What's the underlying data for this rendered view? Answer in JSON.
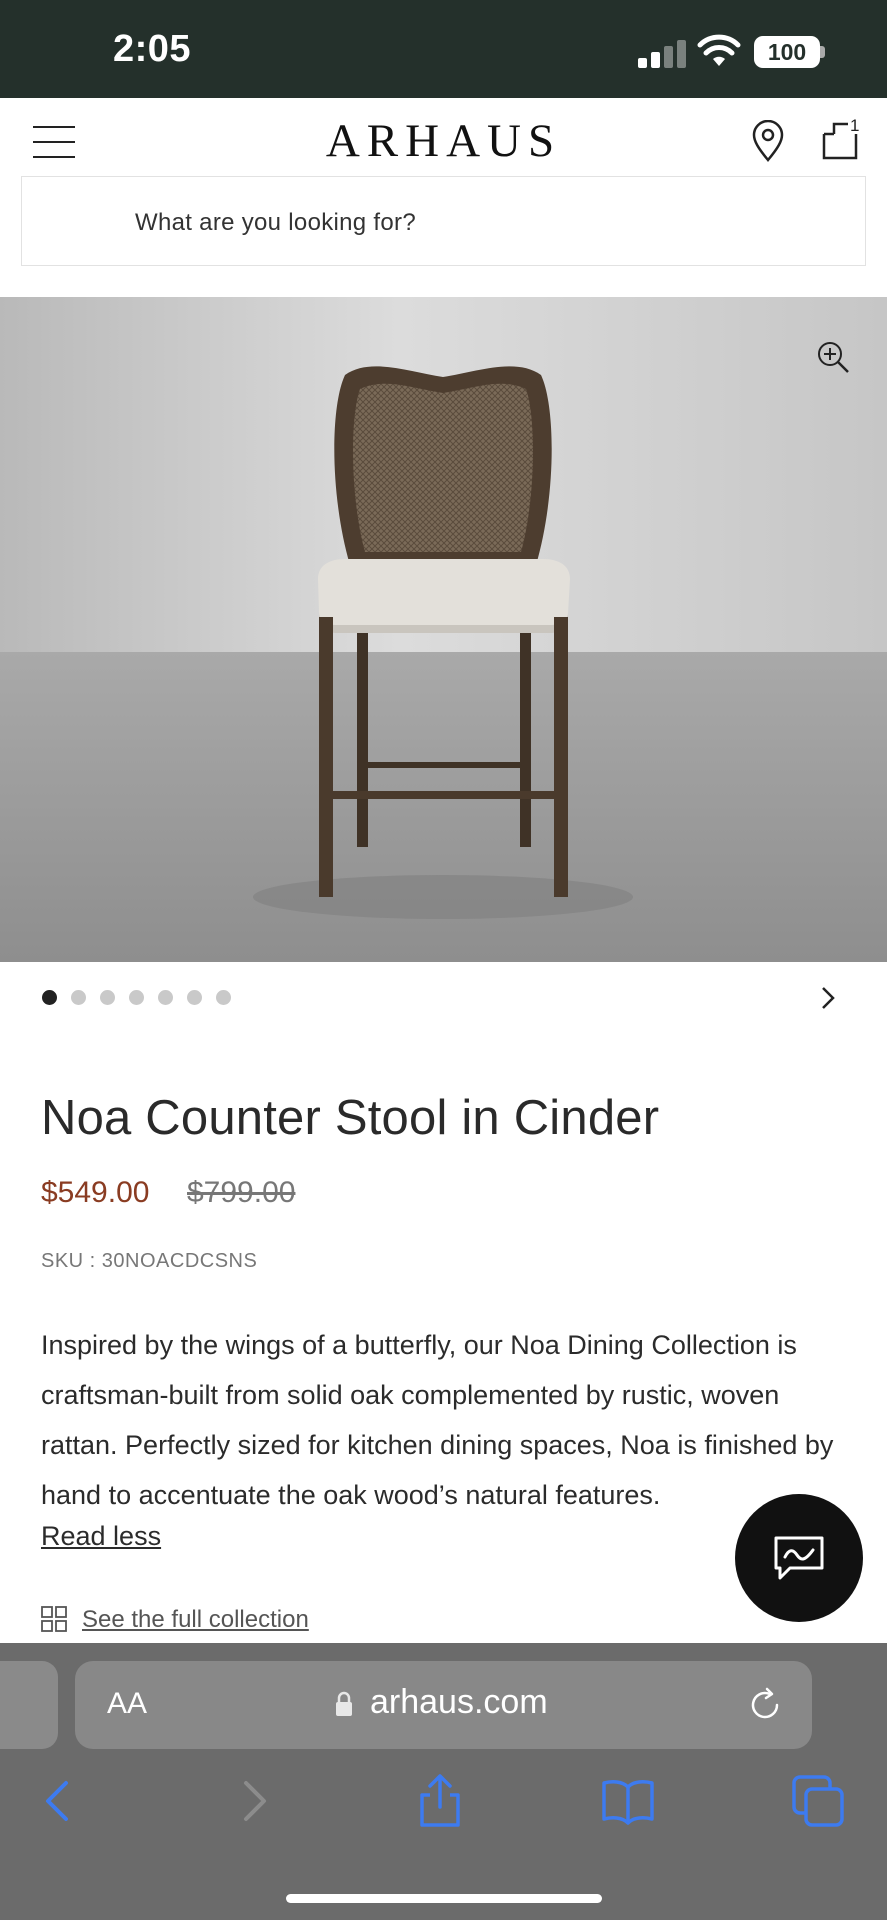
{
  "status_bar": {
    "time": "2:05",
    "battery": "100"
  },
  "header": {
    "logo": "ARHAUS",
    "cart_count": "1"
  },
  "search": {
    "placeholder": "What are you looking for?"
  },
  "carousel": {
    "dot_count": 7,
    "active_index": 0
  },
  "product": {
    "title": "Noa Counter Stool in Cinder",
    "sale_price": "$549.00",
    "original_price": "$799.00",
    "sku": "SKU : 30NOACDCSNS",
    "description": "Inspired by the wings of a butterfly, our Noa Dining Collection is craftsman-built from solid oak complemented by rustic, woven rattan. Perfectly sized for kitchen dining spaces, Noa is finished by hand to accentuate the oak wood’s natural features.",
    "read_less": "Read less",
    "collection_link": "See the full collection"
  },
  "browser": {
    "text_size_label": "AA",
    "url": "arhaus.com"
  },
  "colors": {
    "status_bar": "#24302b",
    "sale_price": "#8a3c22",
    "safari_blue": "#3d7bf0"
  }
}
